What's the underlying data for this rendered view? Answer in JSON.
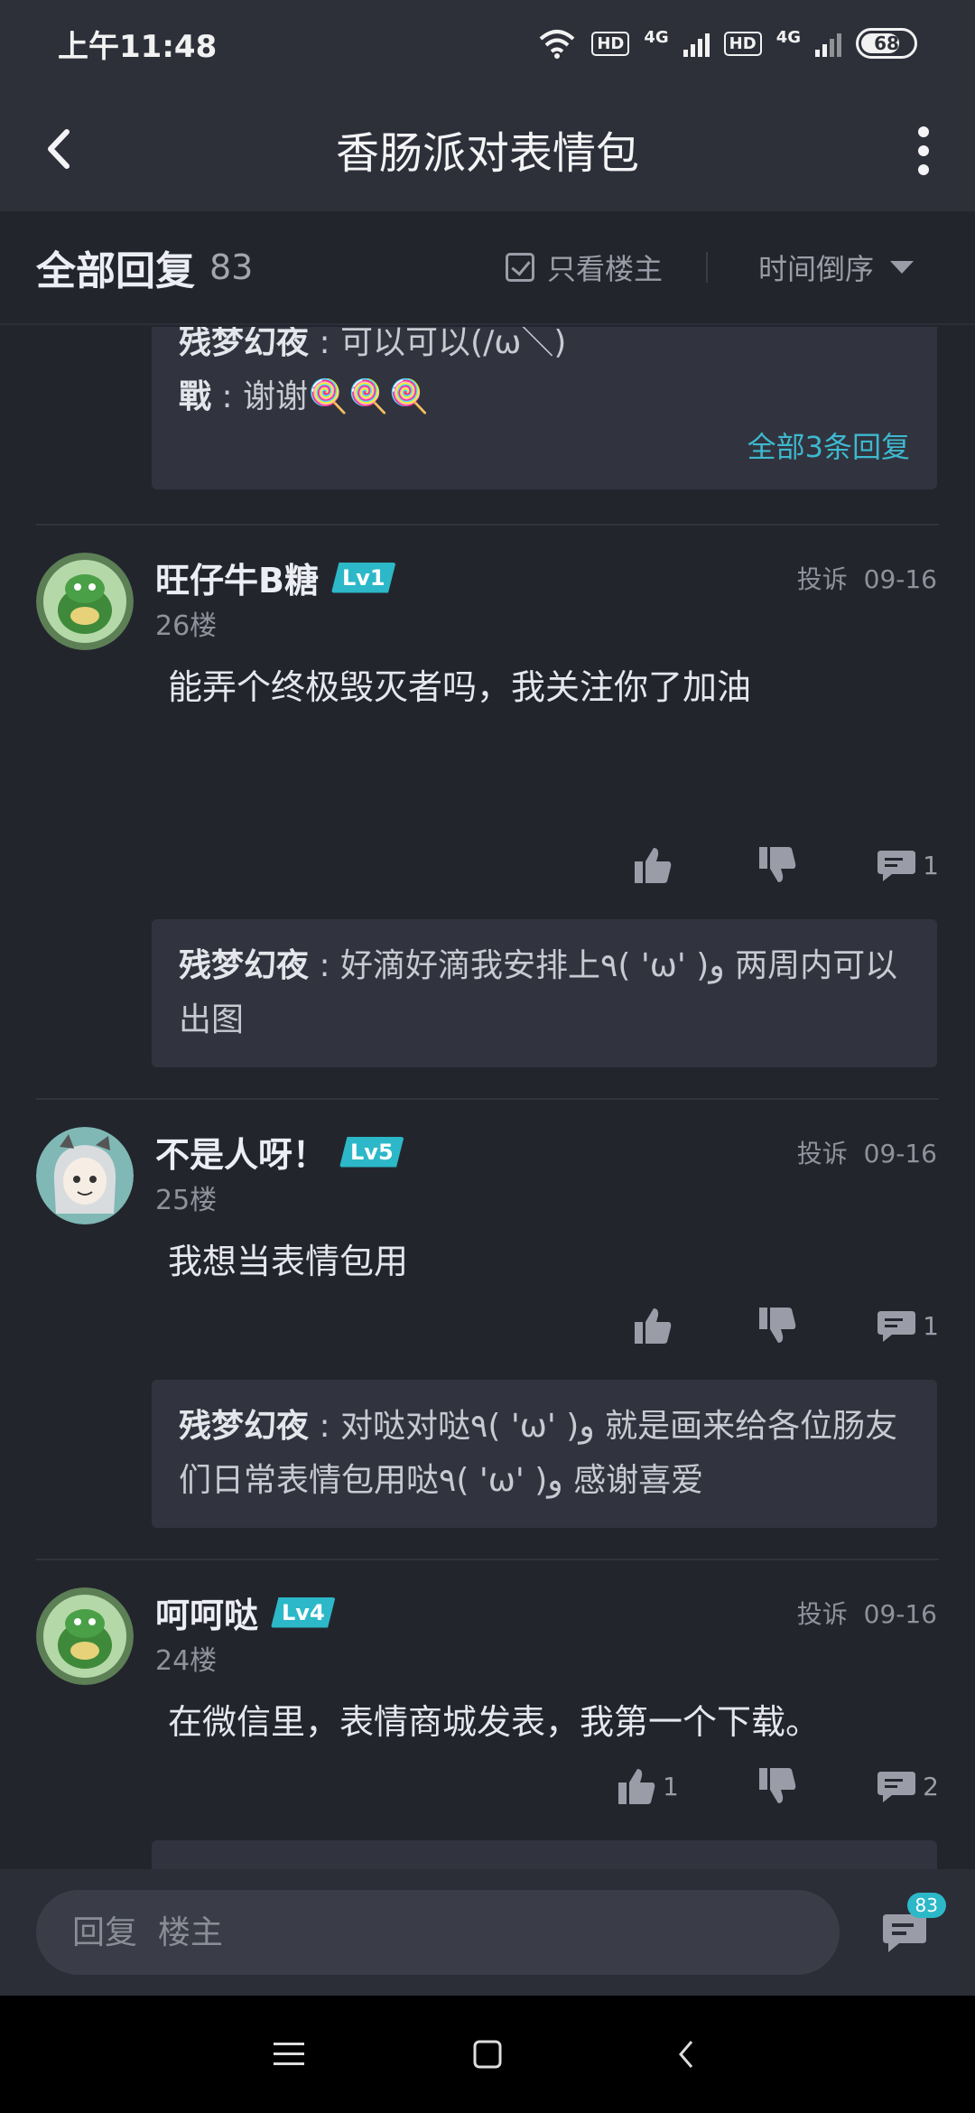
{
  "status": {
    "time": "上午11:48",
    "hd1": "HD",
    "net1": "4G",
    "hd2": "HD",
    "net2": "4G",
    "battery": "68"
  },
  "header": {
    "title": "香肠派对表情包"
  },
  "filter": {
    "all_label": "全部回复",
    "count": "83",
    "only_op": "只看楼主",
    "order": "时间倒序"
  },
  "top_partial": {
    "replies": [
      {
        "author": "残梦幻夜",
        "sep": " : ",
        "text": "可以可以(/ω＼)"
      },
      {
        "author": "戰",
        "sep": " : ",
        "text": "谢谢🍭🍭🍭"
      }
    ],
    "more": "全部3条回复"
  },
  "posts": [
    {
      "name": "旺仔牛B糖",
      "level": "Lv1",
      "floor": "26楼",
      "report": "投诉",
      "date": "09-16",
      "text": "能弄个终极毁灭者吗，我关注你了加油",
      "likes": "",
      "comments": "1",
      "reply": {
        "author": "残梦幻夜",
        "sep": " : ",
        "text": "好滴好滴我安排上٩( 'ω' )و 两周内可以出图"
      }
    },
    {
      "name": "不是人呀！",
      "level": "Lv5",
      "floor": "25楼",
      "report": "投诉",
      "date": "09-16",
      "text": "我想当表情包用",
      "likes": "",
      "comments": "1",
      "reply": {
        "author": "残梦幻夜",
        "sep": " : ",
        "text": "对哒对哒٩( 'ω' )و 就是画来给各位肠友们日常表情包用哒٩( 'ω' )و 感谢喜爱"
      }
    },
    {
      "name": "呵呵哒",
      "level": "Lv4",
      "floor": "24楼",
      "report": "投诉",
      "date": "09-16",
      "text": "在微信里，表情商城发表，我第一个下载。",
      "likes": "1",
      "comments": "2"
    }
  ],
  "bottom": {
    "placeholder": "回复  楼主",
    "badge": "83"
  },
  "colors": {
    "accent": "#2cb8c8",
    "link": "#3eb8cf",
    "bg": "#23252d",
    "card": "#31343e"
  }
}
